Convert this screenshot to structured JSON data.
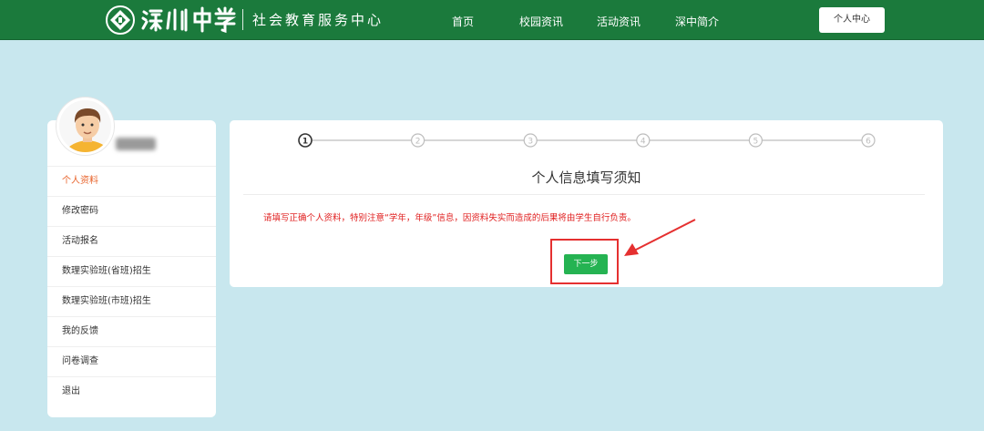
{
  "header": {
    "logo_name": "深圳中学",
    "logo_sub": "社会教育服务中心",
    "nav": [
      "首页",
      "校园资讯",
      "活动资讯",
      "深中简介"
    ],
    "user_center": "个人中心",
    "brand_color": "#1b7a3c"
  },
  "sidebar": {
    "items": [
      {
        "label": "个人资料",
        "active": true
      },
      {
        "label": "修改密码"
      },
      {
        "label": "活动报名"
      },
      {
        "label": "数理实验班(省班)招生"
      },
      {
        "label": "数理实验班(市班)招生"
      },
      {
        "label": "我的反馈"
      },
      {
        "label": "问卷调查"
      },
      {
        "label": "退出"
      }
    ]
  },
  "steps": {
    "labels": [
      "1",
      "2",
      "3",
      "4",
      "5",
      "6"
    ],
    "current": 1
  },
  "main": {
    "title": "个人信息填写须知",
    "notice": "请填写正确个人资料，特别注意“学年，年级”信息，因资料失实而造成的后果将由学生自行负责。",
    "next_label": "下一步"
  },
  "colors": {
    "page_bg": "#c8e7ee",
    "active_menu": "#e8632b",
    "notice": "#e02020",
    "next_button": "#25b352",
    "annotation": "#e53030"
  }
}
